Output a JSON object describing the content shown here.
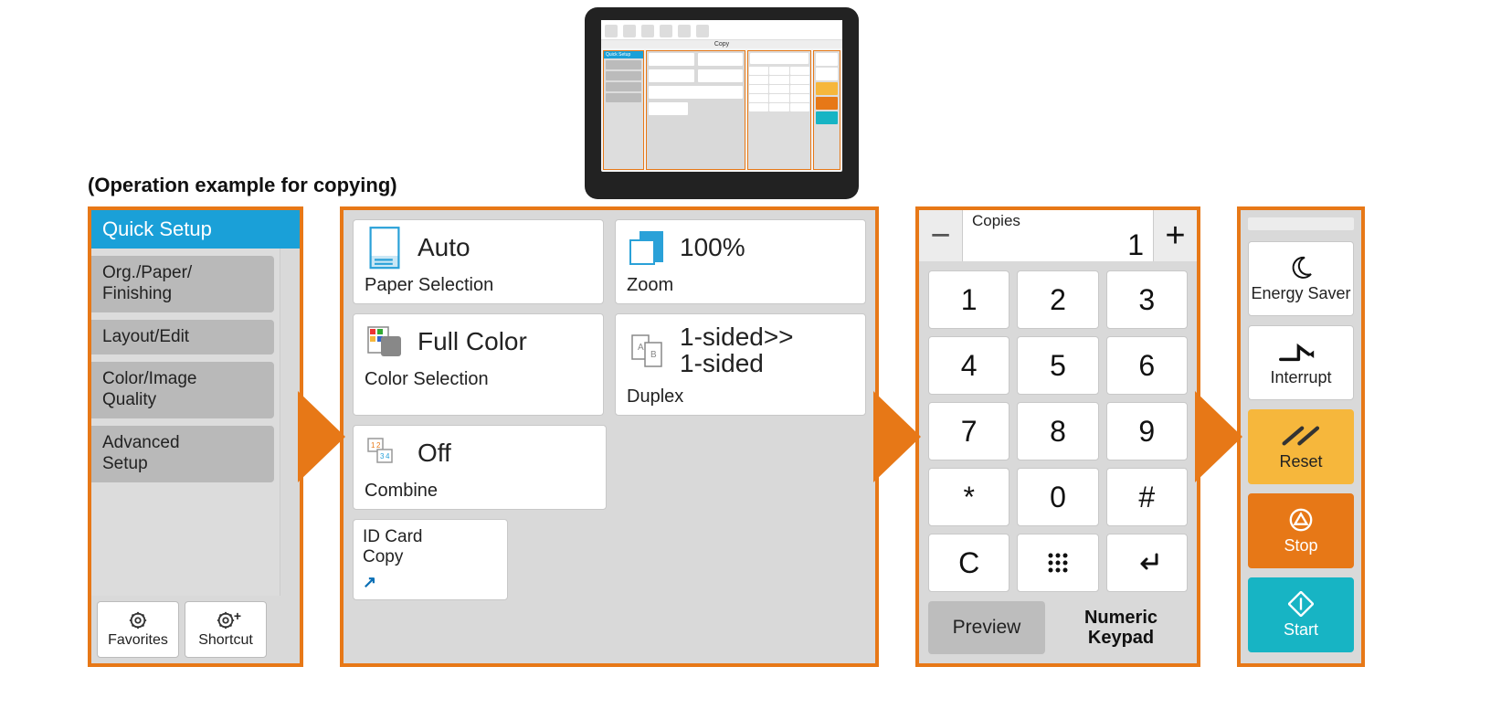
{
  "caption": "(Operation example for copying)",
  "tablet": {
    "title": "Copy"
  },
  "sidebar": {
    "header": "Quick Setup",
    "tabs": [
      "Org./Paper/\nFinishing",
      "Layout/Edit",
      "Color/Image\nQuality",
      "Advanced\nSetup"
    ],
    "bottom": {
      "favorites": "Favorites",
      "shortcut": "Shortcut"
    }
  },
  "options": {
    "paper": {
      "value": "Auto",
      "label": "Paper Selection"
    },
    "zoom": {
      "value": "100%",
      "label": "Zoom"
    },
    "color": {
      "value": "Full Color",
      "label": "Color Selection"
    },
    "duplex": {
      "value": "1-sided>>\n1-sided",
      "label": "Duplex"
    },
    "combine": {
      "value": "Off",
      "label": "Combine"
    },
    "idcard": {
      "label": "ID Card\nCopy"
    }
  },
  "keypad": {
    "copies_label": "Copies",
    "copies_value": "1",
    "keys": [
      "1",
      "2",
      "3",
      "4",
      "5",
      "6",
      "7",
      "8",
      "9",
      "*",
      "0",
      "#",
      "C",
      "⠿",
      "↵"
    ],
    "preview": "Preview",
    "numeric_label": "Numeric\nKeypad"
  },
  "actions": {
    "energy": "Energy Saver",
    "interrupt": "Interrupt",
    "reset": "Reset",
    "stop": "Stop",
    "start": "Start"
  }
}
